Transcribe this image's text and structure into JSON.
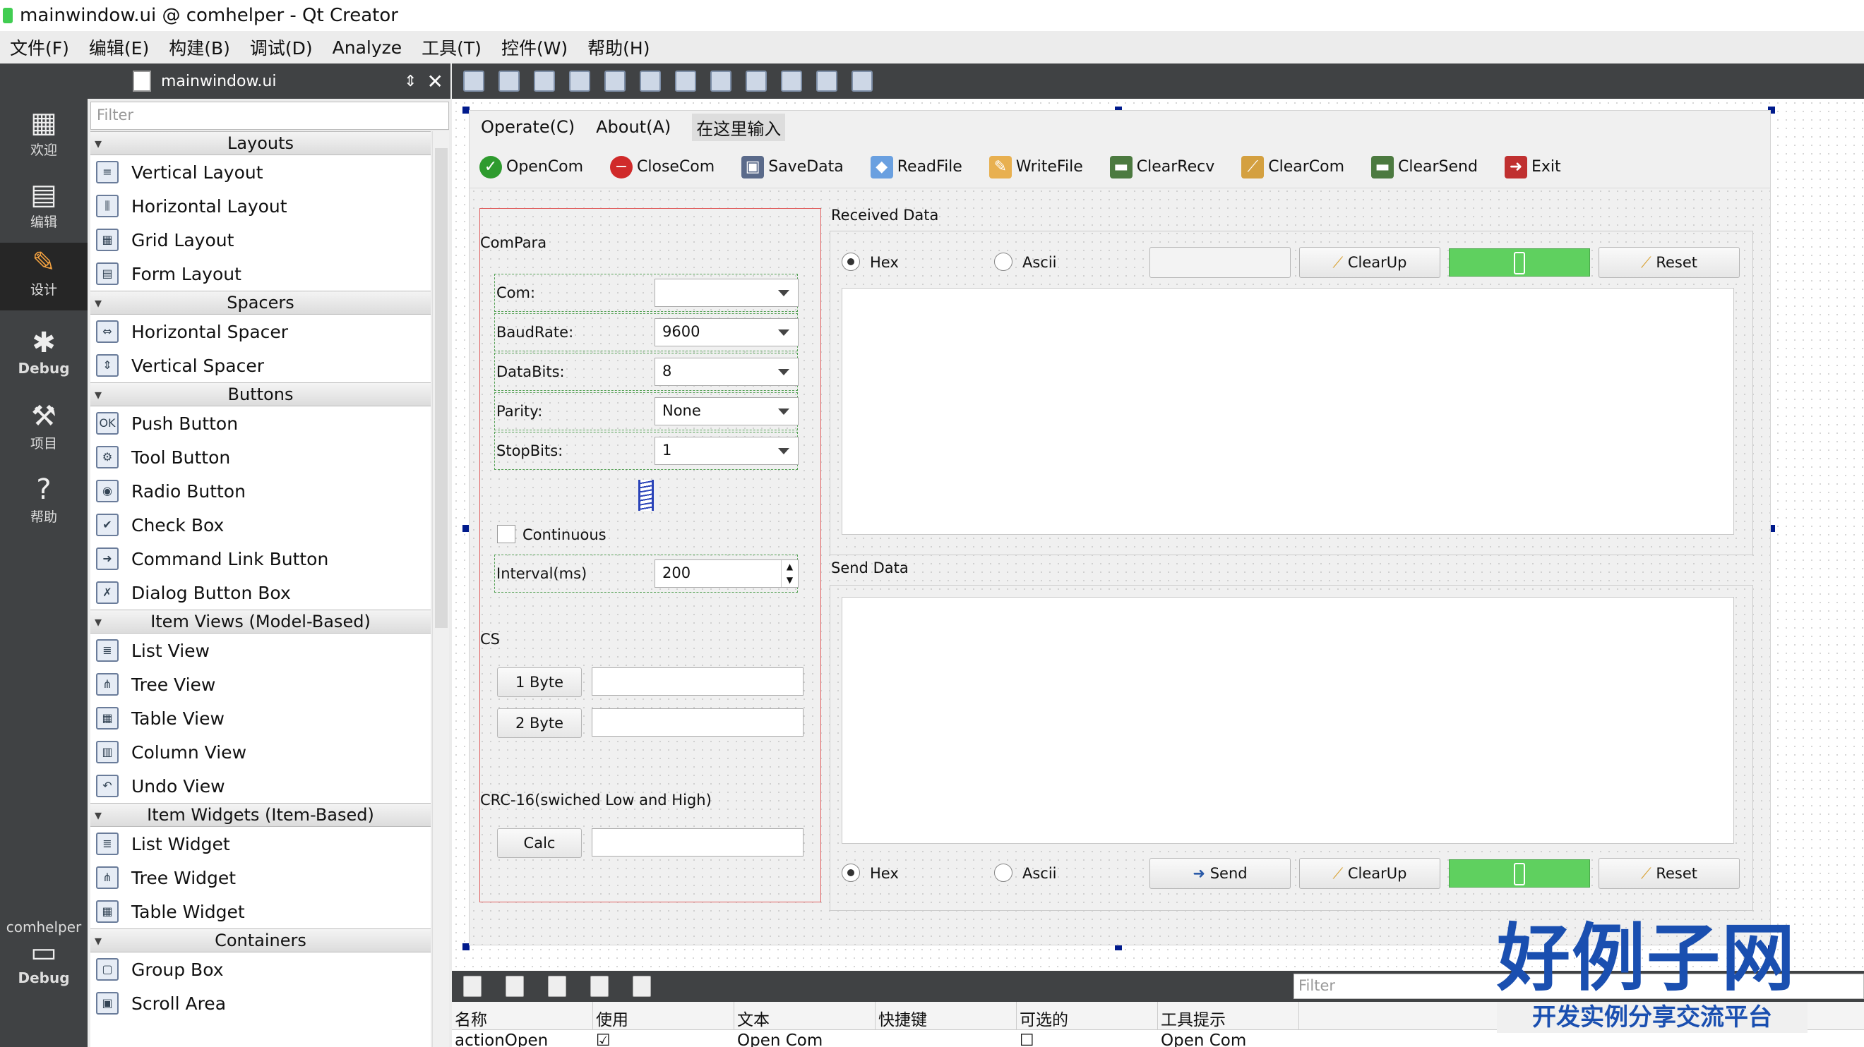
{
  "window": {
    "title": "mainwindow.ui @ comhelper - Qt Creator"
  },
  "menu": [
    "文件(F)",
    "编辑(E)",
    "构建(B)",
    "调试(D)",
    "Analyze",
    "工具(T)",
    "控件(W)",
    "帮助(H)"
  ],
  "modes": [
    {
      "label": "欢迎",
      "icon": "welcome-grid-icon"
    },
    {
      "label": "编辑",
      "icon": "edit-doc-icon"
    },
    {
      "label": "设计",
      "icon": "design-pencil-icon"
    },
    {
      "label": "Debug",
      "icon": "debug-bug-icon"
    },
    {
      "label": "项目",
      "icon": "project-wrench-icon"
    },
    {
      "label": "帮助",
      "icon": "help-question-icon"
    }
  ],
  "target": {
    "project": "comhelper",
    "mode": "Debug"
  },
  "editor": {
    "file": "mainwindow.ui",
    "filter_placeholder": "Filter"
  },
  "widgetbox": {
    "categories": [
      {
        "name": "Layouts",
        "items": [
          "Vertical Layout",
          "Horizontal Layout",
          "Grid Layout",
          "Form Layout"
        ]
      },
      {
        "name": "Spacers",
        "items": [
          "Horizontal Spacer",
          "Vertical Spacer"
        ]
      },
      {
        "name": "Buttons",
        "items": [
          "Push Button",
          "Tool Button",
          "Radio Button",
          "Check Box",
          "Command Link Button",
          "Dialog Button Box"
        ]
      },
      {
        "name": "Item Views (Model-Based)",
        "items": [
          "List View",
          "Tree View",
          "Table View",
          "Column View",
          "Undo View"
        ]
      },
      {
        "name": "Item Widgets (Item-Based)",
        "items": [
          "List Widget",
          "Tree Widget",
          "Table Widget"
        ]
      },
      {
        "name": "Containers",
        "items": [
          "Group Box",
          "Scroll Area"
        ]
      }
    ]
  },
  "form": {
    "menu": [
      "Operate(C)",
      "About(A)",
      "在这里输入"
    ],
    "toolbar": [
      "OpenCom",
      "CloseCom",
      "SaveData",
      "ReadFile",
      "WriteFile",
      "ClearRecv",
      "ClearCom",
      "ClearSend",
      "Exit"
    ],
    "compara": {
      "title": "ComPara",
      "rows": [
        {
          "label": "Com:",
          "value": ""
        },
        {
          "label": "BaudRate:",
          "value": "9600"
        },
        {
          "label": "DataBits:",
          "value": "8"
        },
        {
          "label": "Parity:",
          "value": "None"
        },
        {
          "label": "StopBits:",
          "value": "1"
        }
      ],
      "continuous": "Continuous",
      "interval_label": "Interval(ms)",
      "interval_value": "200"
    },
    "cs": {
      "title": "CS",
      "btn1": "1 Byte",
      "btn2": "2 Byte"
    },
    "crc": {
      "title": "CRC-16(swiched Low and High)",
      "btn": "Calc"
    },
    "received": {
      "title": "Received Data",
      "hex": "Hex",
      "ascii": "Ascii",
      "clear": "ClearUp",
      "reset": "Reset"
    },
    "send": {
      "title": "Send Data",
      "hex": "Hex",
      "ascii": "Ascii",
      "send": "Send",
      "clear": "ClearUp",
      "reset": "Reset"
    }
  },
  "action_editor": {
    "filter_placeholder": "Filter",
    "columns": [
      "名称",
      "使用",
      "文本",
      "快捷键",
      "可选的",
      "工具提示"
    ],
    "row": {
      "name": "actionOpen",
      "text": "Open Com",
      "tooltip": "Open Com"
    }
  },
  "watermark": {
    "big": "好例子网",
    "small": "开发实例分享交流平台"
  }
}
